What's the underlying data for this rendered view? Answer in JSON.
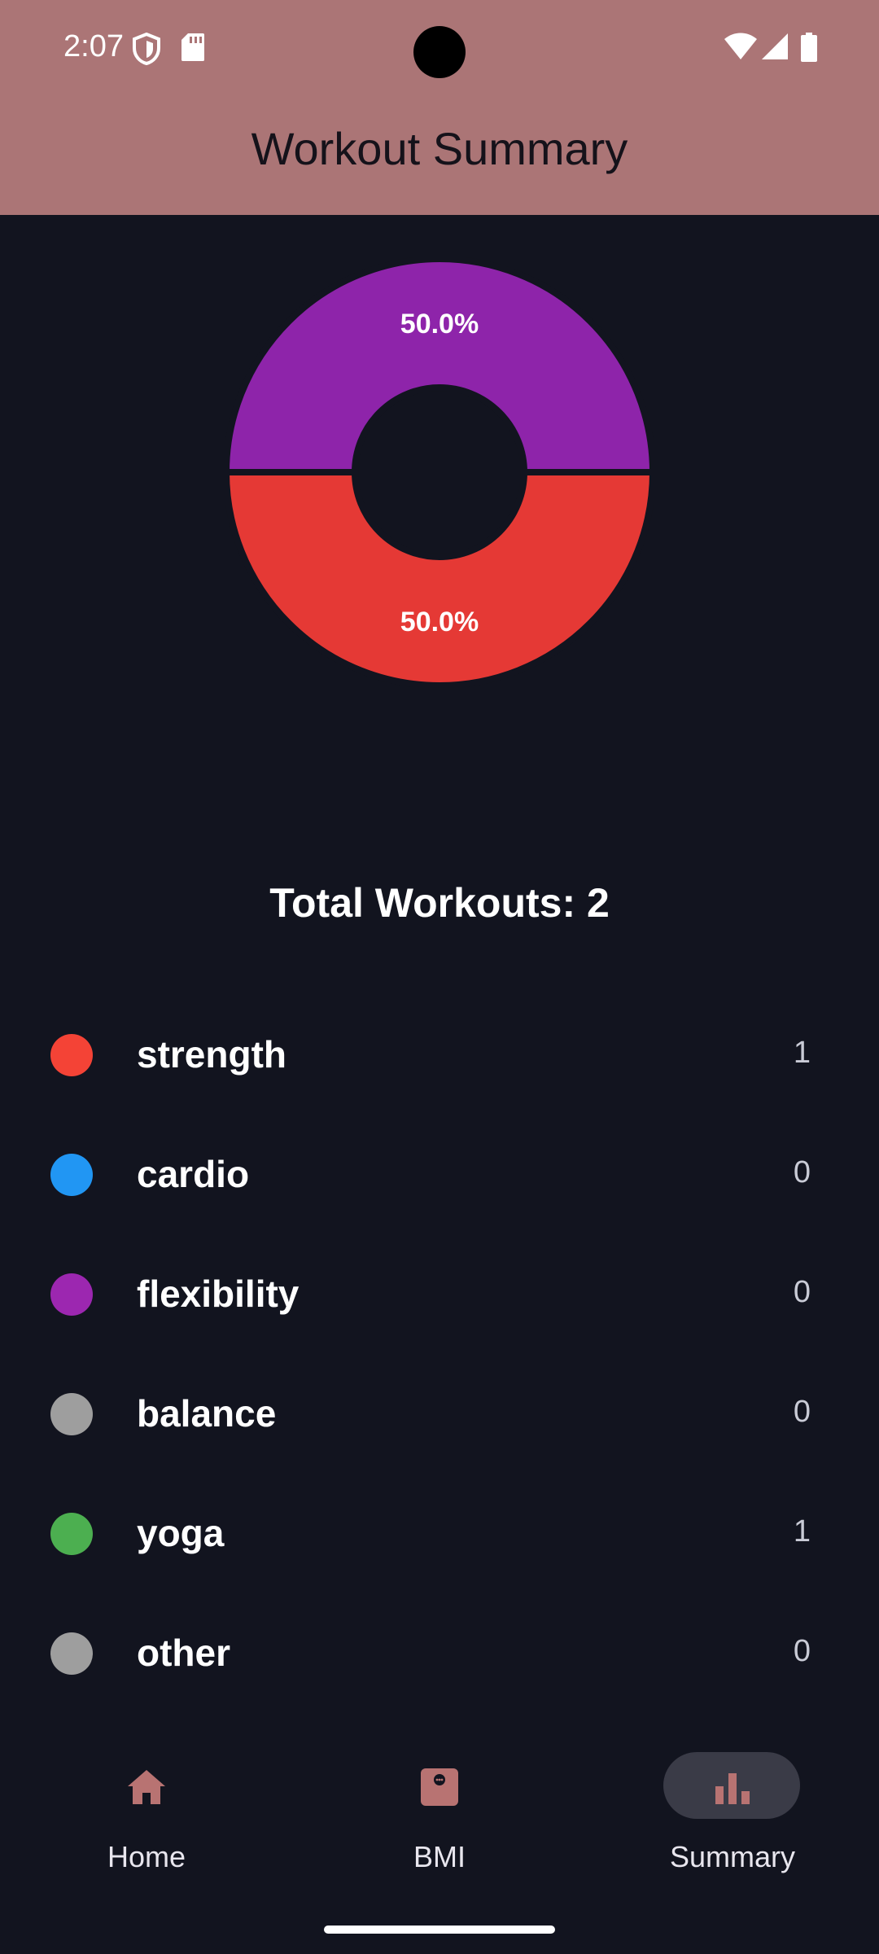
{
  "status_bar": {
    "time": "2:07"
  },
  "header": {
    "title": "Workout Summary"
  },
  "colors": {
    "header_bg": "#ab7576",
    "background": "#12141f",
    "accent": "#b87372"
  },
  "chart_data": {
    "type": "pie",
    "style": "donut",
    "slices": [
      {
        "category": "flexibility",
        "value": 50.0,
        "label": "50.0%",
        "color": "#8e24aa"
      },
      {
        "category": "strength",
        "value": 50.0,
        "label": "50.0%",
        "color": "#e53935"
      }
    ]
  },
  "summary": {
    "total_label": "Total Workouts: 2"
  },
  "legend": [
    {
      "name": "strength",
      "count": "1",
      "color": "#f44336"
    },
    {
      "name": "cardio",
      "count": "0",
      "color": "#2196f3"
    },
    {
      "name": "flexibility",
      "count": "0",
      "color": "#9c27b0"
    },
    {
      "name": "balance",
      "count": "0",
      "color": "#9e9e9e"
    },
    {
      "name": "yoga",
      "count": "1",
      "color": "#4caf50"
    },
    {
      "name": "other",
      "count": "0",
      "color": "#9e9e9e"
    }
  ],
  "nav": {
    "items": [
      {
        "label": "Home",
        "icon": "home-icon",
        "active": false
      },
      {
        "label": "BMI",
        "icon": "scale-icon",
        "active": false
      },
      {
        "label": "Summary",
        "icon": "bar-chart-icon",
        "active": true
      }
    ]
  }
}
